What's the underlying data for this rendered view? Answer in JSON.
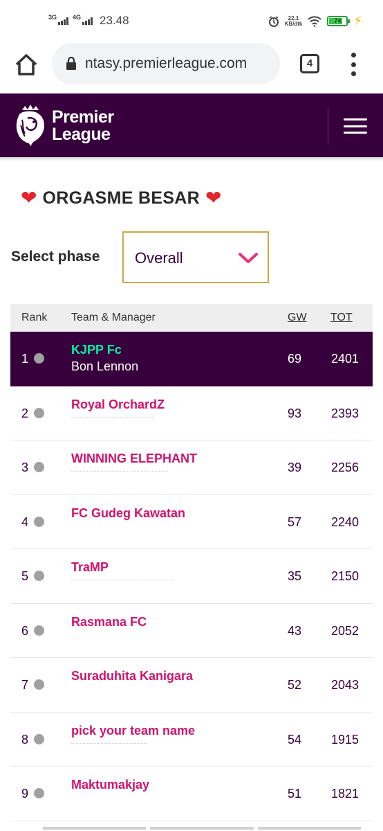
{
  "status_bar": {
    "net1": "3G",
    "net2": "4G",
    "time": "23.48",
    "speed_value": "22,1",
    "speed_unit": "KB/dtk",
    "battery_level": "74"
  },
  "browser": {
    "url": "ntasy.premierleague.com",
    "tab_count": "4"
  },
  "header": {
    "brand_line1": "Premier",
    "brand_line2": "League"
  },
  "league": {
    "name": "ORGASME BESAR",
    "heart": "❤"
  },
  "phase": {
    "label": "Select phase",
    "value": "Overall"
  },
  "table": {
    "headers": {
      "rank": "Rank",
      "team": "Team & Manager",
      "gw": "GW",
      "tot": "TOT"
    },
    "rows": [
      {
        "rank": "1",
        "team": "KJPP Fc",
        "manager": "Bon Lennon",
        "gw": "69",
        "tot": "2401"
      },
      {
        "rank": "2",
        "team": "Royal OrchardZ",
        "manager": "",
        "gw": "93",
        "tot": "2393"
      },
      {
        "rank": "3",
        "team": "WINNING ELEPHANT",
        "manager": "",
        "gw": "39",
        "tot": "2256"
      },
      {
        "rank": "4",
        "team": "FC Gudeg Kawatan",
        "manager": "",
        "gw": "57",
        "tot": "2240"
      },
      {
        "rank": "5",
        "team": "TraMP",
        "manager": "",
        "gw": "35",
        "tot": "2150"
      },
      {
        "rank": "6",
        "team": "Rasmana FC",
        "manager": "",
        "gw": "43",
        "tot": "2052"
      },
      {
        "rank": "7",
        "team": "Suraduhita Kanigara",
        "manager": "",
        "gw": "52",
        "tot": "2043"
      },
      {
        "rank": "8",
        "team": "pick your team name",
        "manager": "",
        "gw": "54",
        "tot": "1915"
      },
      {
        "rank": "9",
        "team": "Maktumakjay",
        "manager": "",
        "gw": "51",
        "tot": "1821"
      }
    ]
  },
  "colors": {
    "pl_purple": "#37003c",
    "pl_pink": "#d0146c",
    "pl_green": "#05f0a4",
    "select_border": "#c9a94a",
    "heart": "#e3262e"
  }
}
